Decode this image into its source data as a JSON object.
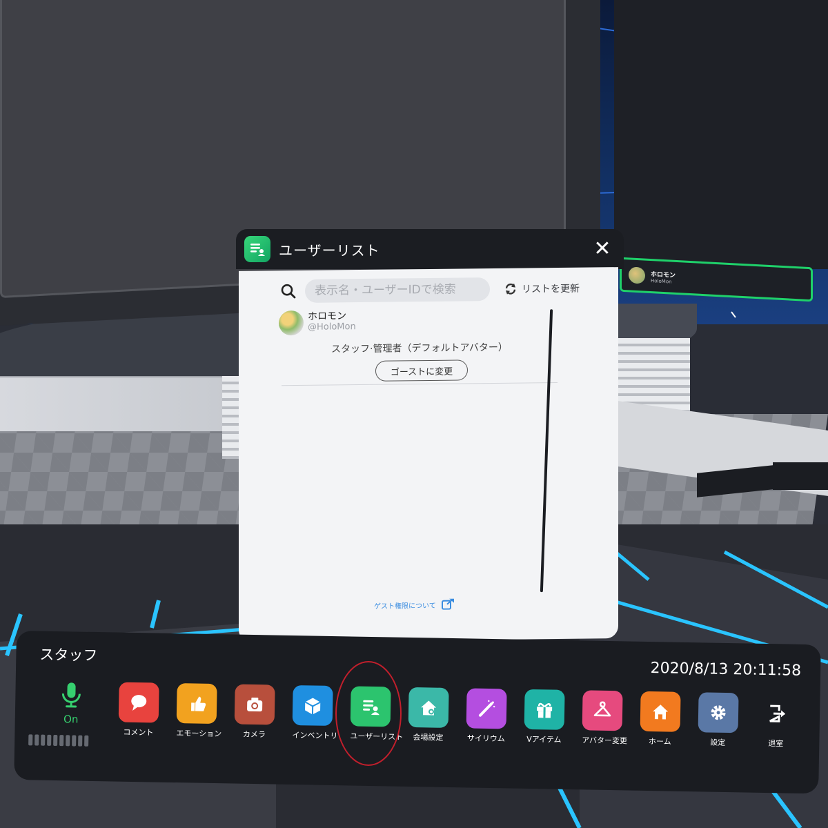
{
  "panel": {
    "title": "ユーザーリスト",
    "close_glyph": "✕",
    "search": {
      "placeholder": "表示名・ユーザーIDで検索"
    },
    "refresh_label": "リストを更新",
    "users": [
      {
        "name": "ホロモン",
        "handle": "@HoloMon",
        "role": "スタッフ·管理者（デフォルトアバター）",
        "action_label": "ゴーストに変更"
      }
    ],
    "guest_link": "ゲスト権限について"
  },
  "mini_card": {
    "name": "ホロモン",
    "handle": "HoloMon"
  },
  "dock": {
    "role_label": "スタッフ",
    "datetime": "2020/8/13 20:11:58",
    "mic": {
      "status": "On",
      "level_bars": 10
    },
    "items": [
      {
        "label": "コメント",
        "icon": "speech-bubble-icon",
        "color": "#e8433e"
      },
      {
        "label": "エモーション",
        "icon": "thumbs-up-icon",
        "color": "#f2a21f"
      },
      {
        "label": "カメラ",
        "icon": "camera-icon",
        "color": "#b84f3c"
      },
      {
        "label": "インベントリ",
        "icon": "box-icon",
        "color": "#1f8fe0"
      },
      {
        "label": "ユーザーリスト",
        "icon": "user-list-icon",
        "color": "#2cc46e"
      },
      {
        "label": "会場設定",
        "icon": "venue-settings-icon",
        "color": "#3bb8a8"
      },
      {
        "label": "サイリウム",
        "icon": "glowstick-icon",
        "color": "#b44ee0"
      },
      {
        "label": "Vアイテム",
        "icon": "gift-icon",
        "color": "#1fb3a6"
      },
      {
        "label": "アバター変更",
        "icon": "hanger-icon",
        "color": "#e64a7e"
      },
      {
        "label": "ホーム",
        "icon": "home-icon",
        "color": "#f27a1f"
      },
      {
        "label": "設定",
        "icon": "gear-icon",
        "color": "#5a78a6"
      },
      {
        "label": "退室",
        "icon": "exit-icon",
        "color": "transparent"
      }
    ]
  }
}
